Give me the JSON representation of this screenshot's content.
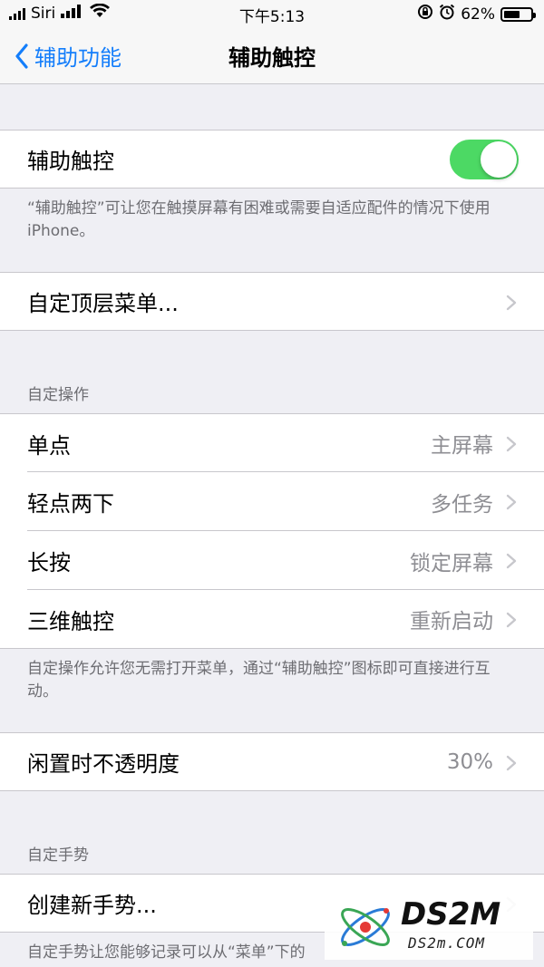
{
  "status_bar": {
    "carrier": "Siri",
    "time": "下午5:13",
    "battery": "62%",
    "battery_level": 0.62
  },
  "nav": {
    "back_label": "辅助功能",
    "title": "辅助触控"
  },
  "assistive_touch": {
    "label": "辅助触控",
    "enabled": true,
    "footer": "“辅助触控”可让您在触摸屏幕有困难或需要自适应配件的情况下使用 iPhone。"
  },
  "top_menu": {
    "label": "自定顶层菜单..."
  },
  "custom_actions": {
    "header": "自定操作",
    "items": [
      {
        "label": "单点",
        "value": "主屏幕"
      },
      {
        "label": "轻点两下",
        "value": "多任务"
      },
      {
        "label": "长按",
        "value": "锁定屏幕"
      },
      {
        "label": "三维触控",
        "value": "重新启动"
      }
    ],
    "footer": "自定操作允许您无需打开菜单，通过“辅助触控”图标即可直接进行互动。"
  },
  "idle_opacity": {
    "label": "闲置时不透明度",
    "value": "30%"
  },
  "custom_gestures": {
    "header": "自定手势",
    "create_label": "创建新手势...",
    "footer": "自定手势让您能够记录可以从“菜单”下的"
  },
  "watermark": {
    "text": "DS2M",
    "sub": "DS2m.COM"
  },
  "colors": {
    "accent": "#147efb",
    "toggle_on": "#4cd964",
    "background": "#efeff4",
    "secondary_text": "#8e8e93"
  }
}
